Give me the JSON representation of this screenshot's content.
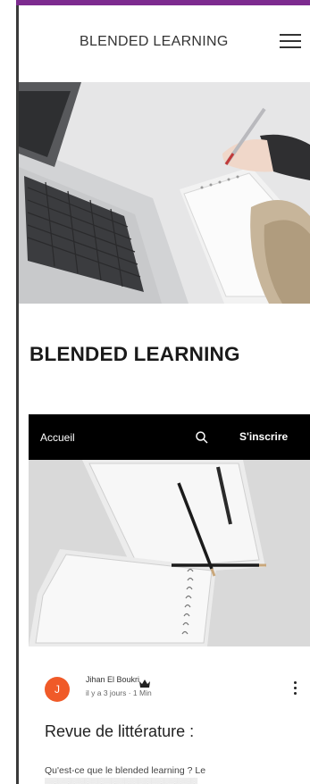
{
  "header": {
    "site_title": "BLENDED LEARNING",
    "menu_icon": "hamburger-icon"
  },
  "page": {
    "heading": "BLENDED LEARNING"
  },
  "blog": {
    "nav": {
      "home_label": "Accueil",
      "search_icon": "search-icon",
      "signup_label": "S'inscrire"
    },
    "post": {
      "author_initial": "J",
      "author_name": "Jihan El Boukri",
      "author_badge_icon": "crown-icon",
      "meta": "il y a 3 jours · 1 Min",
      "title": "Revue de littérature :",
      "excerpt": "Qu'est-ce que le blended learning ? Le",
      "more_icon": "more-vertical-icon"
    }
  },
  "colors": {
    "top_accent": "#7d2b8f",
    "nav_background": "#000000",
    "avatar": "#f05a28"
  }
}
